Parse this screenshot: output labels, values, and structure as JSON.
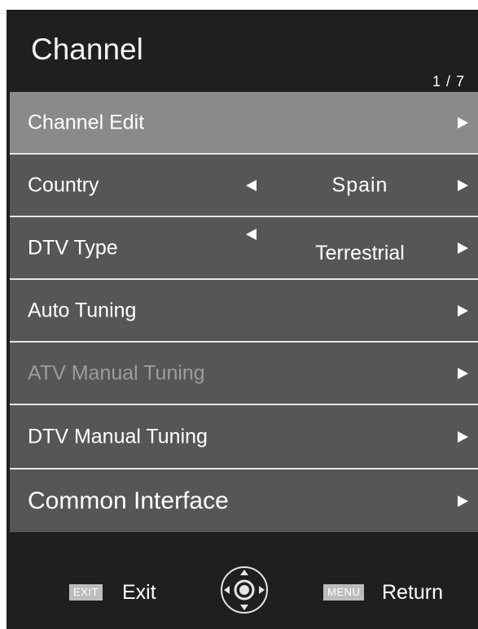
{
  "menu": {
    "title": "Channel",
    "page_indicator": "1 / 7"
  },
  "items": [
    {
      "label": "Channel Edit"
    },
    {
      "label": "Country",
      "value": "Spain"
    },
    {
      "label": "DTV Type",
      "value": "Terrestrial"
    },
    {
      "label": "Auto Tuning"
    },
    {
      "label": "ATV Manual Tuning"
    },
    {
      "label": "DTV Manual Tuning"
    },
    {
      "label": "Common Interface"
    }
  ],
  "footer": {
    "exit_key": "EXIT",
    "exit_label": "Exit",
    "menu_key": "MENU",
    "menu_label": "Return"
  },
  "icons": {
    "right_arrow": "right-arrow-icon",
    "left_arrow": "left-arrow-icon",
    "navigation_pad": "navigation-pad-icon"
  },
  "colors": {
    "panel_background": "#1f1f1f",
    "item_background": "#565656",
    "selected_background": "#8a8a8a",
    "disabled_text": "#9c9c9c",
    "key_badge": "#bdbdbd"
  }
}
